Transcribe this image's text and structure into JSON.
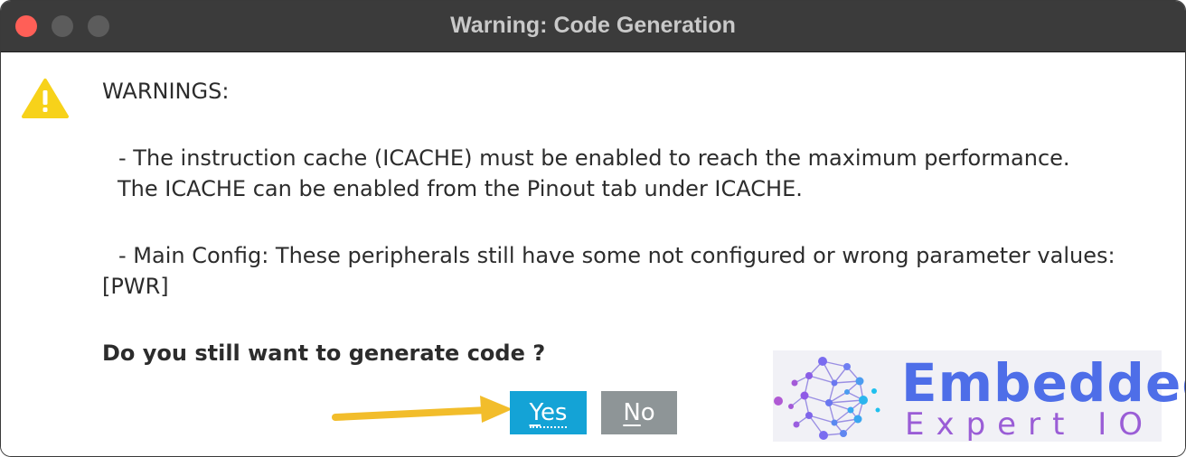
{
  "window": {
    "title": "Warning: Code Generation",
    "traffic_lights": [
      "close",
      "minimize",
      "maximize"
    ]
  },
  "warning_icon": "warning-triangle-icon",
  "content": {
    "heading": "WARNINGS:",
    "warning1_line1": "- The instruction cache (ICACHE) must be enabled to reach the maximum performance.",
    "warning1_line2": "The ICACHE can be enabled from the Pinout tab under ICACHE.",
    "warning2_line1": "- Main Config: These peripherals still have some not configured or wrong parameter values:",
    "warning2_line2": "[PWR]",
    "question": "Do you still want to generate code ?"
  },
  "buttons": {
    "yes_mnemonic": "Y",
    "yes_rest": "es",
    "no_mnemonic": "N",
    "no_rest": "o"
  },
  "logo": {
    "line1": "Embedded",
    "line2": "Expert IO"
  },
  "colors": {
    "yes_button": "#14a3d6",
    "no_button": "#8e9597",
    "arrow": "#f2bd2b",
    "title_bar": "#3b3b3b",
    "close_light": "#ff5f57"
  }
}
